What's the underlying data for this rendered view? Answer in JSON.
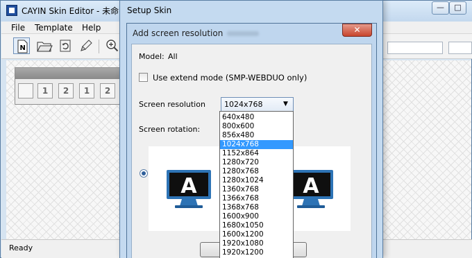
{
  "main_window": {
    "title": "CAYIN Skin Editor - 未命名",
    "min_glyph": "—",
    "max_glyph": "□",
    "menu": [
      "File",
      "Template",
      "Help"
    ],
    "toolbar_icons": [
      "new-document-icon",
      "open-folder-icon",
      "save-icon",
      "pencil-icon",
      "zoom-icon"
    ],
    "panel_icons": [
      {
        "name": "image-icon",
        "glyph": ""
      },
      {
        "name": "screen-1-icon",
        "glyph": "1"
      },
      {
        "name": "screen-2-icon",
        "glyph": "2"
      },
      {
        "name": "page-1-icon",
        "glyph": "1"
      },
      {
        "name": "page-2-icon",
        "glyph": "2"
      }
    ],
    "status": "Ready"
  },
  "setup_window": {
    "title": "Setup Skin"
  },
  "dialog": {
    "title": "Add screen resolution",
    "close_glyph": "✕",
    "model_label": "Model:",
    "model_value": "All",
    "extend_mode_label": "Use extend mode (SMP-WEBDUO only)",
    "extend_mode_checked": false,
    "resolution_label": "Screen resolution",
    "resolution_selected": "1024x768",
    "rotation_label": "Screen rotation:",
    "preview_glyph": "A",
    "resolution_options": [
      "640x480",
      "800x600",
      "856x480",
      "1024x768",
      "1152x864",
      "1280x720",
      "1280x768",
      "1280x1024",
      "1360x768",
      "1366x768",
      "1368x768",
      "1600x900",
      "1680x1050",
      "1600x1200",
      "1920x1080",
      "1920x1200"
    ]
  },
  "colors": {
    "selection": "#3399ff",
    "window_frame": "#c4daf0",
    "close_button": "#c8452d",
    "monitor_blue": "#2d73b5"
  }
}
